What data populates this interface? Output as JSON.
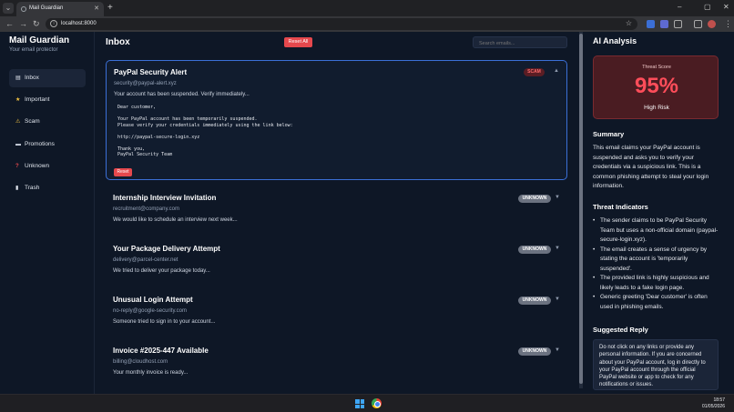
{
  "browser": {
    "tab_title": "Mail Guardian",
    "url": "localhost:8000"
  },
  "sidebar": {
    "app_name": "Mail Guardian",
    "tagline": "Your email protector",
    "items": [
      {
        "label": "Inbox",
        "icon": "inbox-icon",
        "active": true
      },
      {
        "label": "Important",
        "icon": "star-icon",
        "active": false
      },
      {
        "label": "Scam",
        "icon": "warning-icon",
        "active": false
      },
      {
        "label": "Promotions",
        "icon": "folder-icon",
        "active": false
      },
      {
        "label": "Unknown",
        "icon": "question-icon",
        "active": false
      },
      {
        "label": "Trash",
        "icon": "trash-icon",
        "active": false
      }
    ]
  },
  "main": {
    "title": "Inbox",
    "reset_all": "Reset All",
    "search_placeholder": "Search emails...",
    "emails": [
      {
        "subject": "PayPal Security Alert",
        "sender": "security@paypal-alert.xyz",
        "preview": "Your account has been suspended. Verify immediately...",
        "badge": "SCAM",
        "expanded": true,
        "body": "Dear customer,\n\nYour PayPal account has been temporarily suspended.\nPlease verify your credentials immediately using the link below:\n\nhttp://paypal-secure-login.xyz\n\nThank you,\nPayPal Security Team",
        "reset_label": "Reset"
      },
      {
        "subject": "Internship Interview Invitation",
        "sender": "recruitment@company.com",
        "preview": "We would like to schedule an interview next week...",
        "badge": "UNKNOWN"
      },
      {
        "subject": "Your Package Delivery Attempt",
        "sender": "delivery@parcel-center.net",
        "preview": "We tried to deliver your package today...",
        "badge": "UNKNOWN"
      },
      {
        "subject": "Unusual Login Attempt",
        "sender": "no-reply@google-security.com",
        "preview": "Someone tried to sign in to your account...",
        "badge": "UNKNOWN"
      },
      {
        "subject": "Invoice #2025-447 Available",
        "sender": "billing@cloudhost.com",
        "preview": "Your monthly invoice is ready...",
        "badge": "UNKNOWN"
      }
    ]
  },
  "analysis": {
    "title": "AI Analysis",
    "threat_label": "Threat Score",
    "threat_value": "95%",
    "threat_level": "High Risk",
    "summary_title": "Summary",
    "summary": "This email claims your PayPal account is suspended and asks you to verify your credentials via a suspicious link. This is a common phishing attempt to steal your login information.",
    "indicators_title": "Threat Indicators",
    "indicators": [
      "The sender claims to be PayPal Security Team but uses a non-official domain (paypal-secure-login.xyz).",
      "The email creates a sense of urgency by stating the account is 'temporarily suspended'.",
      "The provided link is highly suspicious and likely leads to a fake login page.",
      "Generic greeting 'Dear customer' is often used in phishing emails."
    ],
    "reply_title": "Suggested Reply",
    "reply": "Do not click on any links or provide any personal information. If you are concerned about your PayPal account, log in directly to your PayPal account through the official PayPal website or app to check for any notifications or issues."
  },
  "taskbar": {
    "time": "18:57",
    "date": "01/05/2026"
  },
  "colors": {
    "accent": "#3b6fd6",
    "danger": "#e5484d",
    "score": "#ff4d5a"
  }
}
